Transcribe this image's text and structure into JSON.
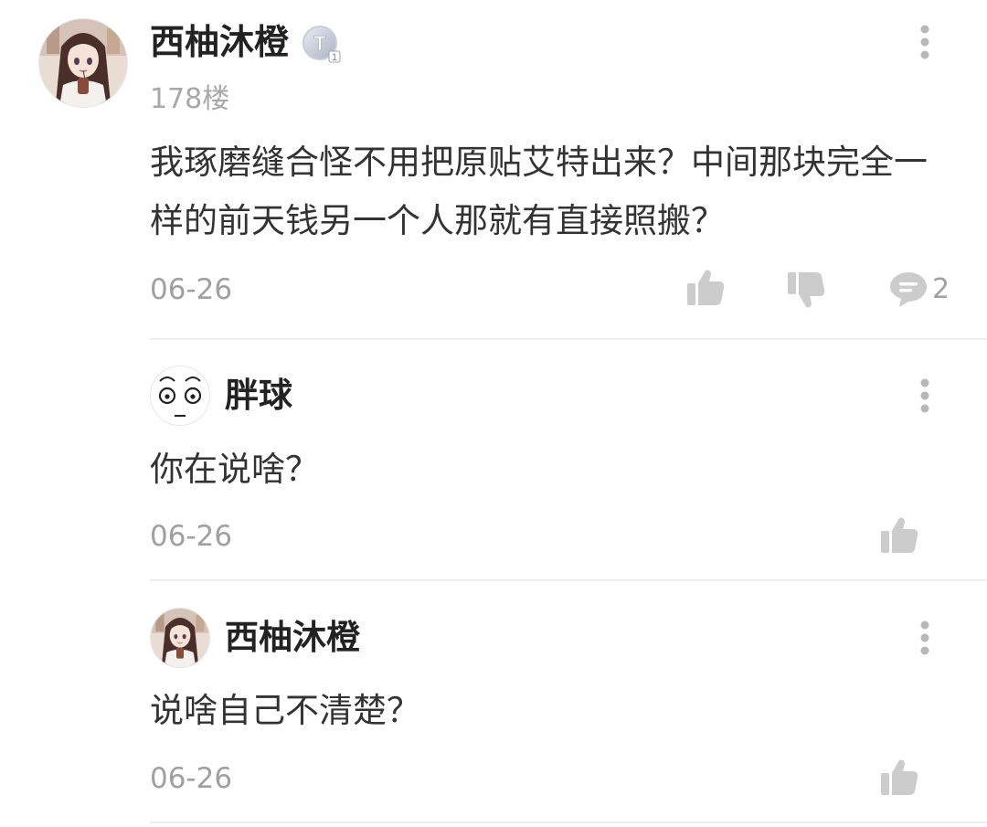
{
  "main_comment": {
    "username": "西柚沐橙",
    "avatar": "anime-girl-avatar",
    "level_badge": {
      "letter": "T",
      "number": "1"
    },
    "floor": "178楼",
    "text": "我琢磨缝合怪不用把原贴艾特出来？中间那块完全一样的前天钱另一个人那就有直接照搬？",
    "date": "06-26",
    "reply_count": "2",
    "icons": [
      "like-icon",
      "dislike-icon",
      "comment-icon",
      "more-icon"
    ]
  },
  "replies": [
    {
      "username": "胖球",
      "avatar": "cartoon-face-avatar",
      "text": "你在说啥？",
      "date": "06-26"
    },
    {
      "username": "西柚沐橙",
      "avatar": "anime-girl-avatar",
      "text": "说啥自己不清楚？",
      "date": "06-26"
    }
  ],
  "colors": {
    "username": "#222222",
    "body_text": "#333333",
    "meta_text": "#a0a0a0",
    "icon": "#cccccc",
    "divider": "#eeeeee"
  }
}
